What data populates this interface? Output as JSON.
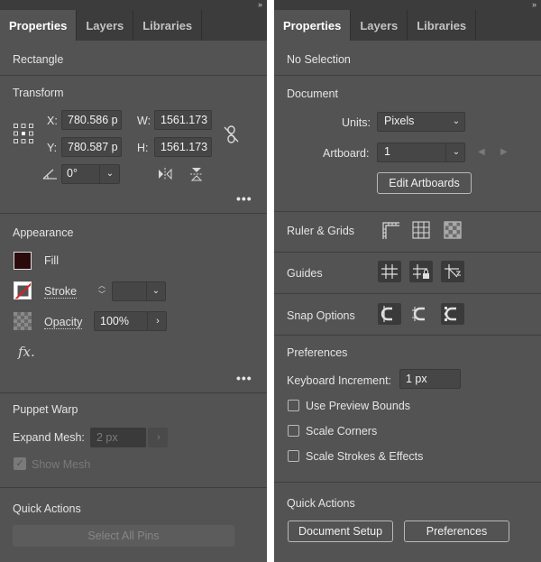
{
  "collapse_glyph": "››",
  "left": {
    "tabs": [
      "Properties",
      "Layers",
      "Libraries"
    ],
    "object_type": "Rectangle",
    "transform": {
      "title": "Transform",
      "x_label": "X:",
      "x_value": "780.586 p",
      "y_label": "Y:",
      "y_value": "780.587 p",
      "w_label": "W:",
      "w_value": "1561.173",
      "h_label": "H:",
      "h_value": "1561.173",
      "angle_value": "0°"
    },
    "appearance": {
      "title": "Appearance",
      "fill_label": "Fill",
      "fill_color": "#2b0a0c",
      "stroke_label": "Stroke",
      "opacity_label": "Opacity",
      "opacity_value": "100%",
      "fx_label": "fx."
    },
    "puppet_warp": {
      "title": "Puppet Warp",
      "expand_label": "Expand Mesh:",
      "expand_value": "2 px",
      "show_mesh_label": "Show Mesh"
    },
    "quick_actions": {
      "title": "Quick Actions",
      "select_pins": "Select All Pins"
    },
    "more": "•••"
  },
  "right": {
    "tabs": [
      "Properties",
      "Layers",
      "Libraries"
    ],
    "selection": "No Selection",
    "document": {
      "title": "Document",
      "units_label": "Units:",
      "units_value": "Pixels",
      "artboard_label": "Artboard:",
      "artboard_value": "1",
      "edit_button": "Edit Artboards"
    },
    "ruler_grids": "Ruler & Grids",
    "guides": "Guides",
    "snap_options": "Snap Options",
    "preferences": {
      "title": "Preferences",
      "keyboard_label": "Keyboard Increment:",
      "keyboard_value": "1 px",
      "checks": [
        "Use Preview Bounds",
        "Scale Corners",
        "Scale Strokes & Effects"
      ]
    },
    "quick_actions": {
      "title": "Quick Actions",
      "doc_setup": "Document Setup",
      "preferences_btn": "Preferences"
    }
  }
}
